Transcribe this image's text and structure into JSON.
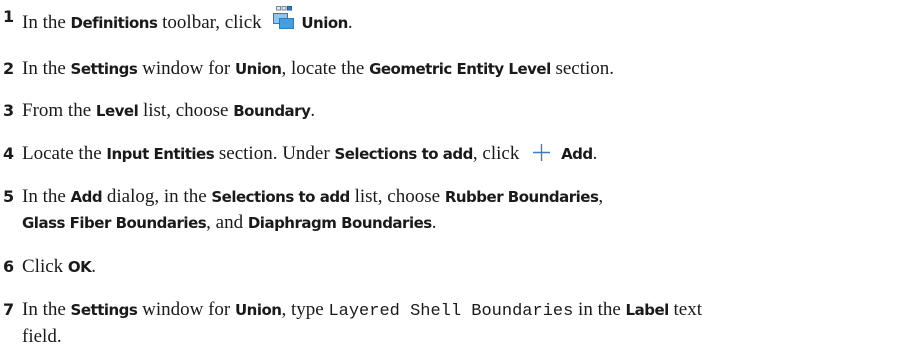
{
  "steps": [
    {
      "num": "1",
      "parts": [
        {
          "t": "In the "
        },
        {
          "t": "Definitions",
          "ui": true
        },
        {
          "t": " toolbar, click "
        },
        {
          "icon": "union-icon"
        },
        {
          "t": "Union",
          "ui": true
        },
        {
          "t": "."
        }
      ]
    },
    {
      "num": "2",
      "parts": [
        {
          "t": "In the "
        },
        {
          "t": "Settings",
          "ui": true
        },
        {
          "t": " window for "
        },
        {
          "t": "Union",
          "ui": true
        },
        {
          "t": ", locate the "
        },
        {
          "t": "Geometric Entity Level",
          "ui": true
        },
        {
          "t": " section."
        }
      ]
    },
    {
      "num": "3",
      "parts": [
        {
          "t": "From the "
        },
        {
          "t": "Level",
          "ui": true
        },
        {
          "t": " list, choose "
        },
        {
          "t": "Boundary",
          "ui": true
        },
        {
          "t": "."
        }
      ]
    },
    {
      "num": "4",
      "parts": [
        {
          "t": "Locate the "
        },
        {
          "t": "Input Entities",
          "ui": true
        },
        {
          "t": " section. Under "
        },
        {
          "t": "Selections to add",
          "ui": true
        },
        {
          "t": ", click "
        },
        {
          "icon": "plus-icon"
        },
        {
          "t": "Add",
          "ui": true
        },
        {
          "t": "."
        }
      ]
    },
    {
      "num": "5",
      "parts": [
        {
          "t": "In the "
        },
        {
          "t": "Add",
          "ui": true
        },
        {
          "t": " dialog, in the "
        },
        {
          "t": "Selections to add",
          "ui": true
        },
        {
          "t": " list, choose "
        },
        {
          "t": "Rubber Boundaries",
          "ui": true
        },
        {
          "t": ","
        }
      ]
    },
    {
      "num": "",
      "parts": [
        {
          "t": "Glass Fiber Boundaries",
          "ui": true
        },
        {
          "t": ", and "
        },
        {
          "t": "Diaphragm Boundaries",
          "ui": true
        },
        {
          "t": "."
        }
      ]
    },
    {
      "num": "6",
      "parts": [
        {
          "t": "Click "
        },
        {
          "t": "OK",
          "ui": true
        },
        {
          "t": "."
        }
      ]
    },
    {
      "num": "7",
      "parts": [
        {
          "t": "In the "
        },
        {
          "t": "Settings",
          "ui": true
        },
        {
          "t": " window for "
        },
        {
          "t": "Union",
          "ui": true
        },
        {
          "t": ", type "
        },
        {
          "t": "Layered Shell Boundaries",
          "mono": true
        },
        {
          "t": " in the "
        },
        {
          "t": "Label",
          "ui": true
        },
        {
          "t": " text"
        }
      ]
    },
    {
      "num": "",
      "parts": [
        {
          "t": "field."
        }
      ]
    }
  ]
}
